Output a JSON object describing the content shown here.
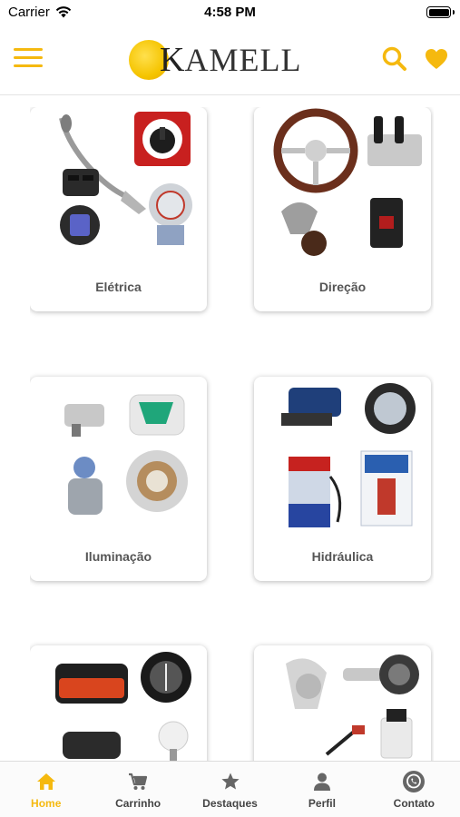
{
  "status_bar": {
    "carrier": "Carrier",
    "time": "4:58 PM",
    "battery_level": 1.0
  },
  "header": {
    "logo_letter": "K",
    "logo_rest": "AMELL",
    "accent_color": "#f5b90f",
    "icons": [
      "menu-icon",
      "search-icon",
      "heart-icon"
    ]
  },
  "categories": [
    {
      "label": "Elétrica"
    },
    {
      "label": "Direção"
    },
    {
      "label": "Iluminação"
    },
    {
      "label": "Hidráulica"
    },
    {
      "label": ""
    },
    {
      "label": ""
    }
  ],
  "tabs": [
    {
      "label": "Home",
      "icon": "home-icon",
      "active": true
    },
    {
      "label": "Carrinho",
      "icon": "cart-icon",
      "active": false
    },
    {
      "label": "Destaques",
      "icon": "star-icon",
      "active": false
    },
    {
      "label": "Perfil",
      "icon": "user-icon",
      "active": false
    },
    {
      "label": "Contato",
      "icon": "whatsapp-icon",
      "active": false
    }
  ]
}
